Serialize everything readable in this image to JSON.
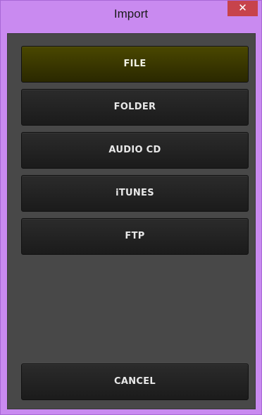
{
  "window": {
    "title": "Import",
    "close_glyph": "✕"
  },
  "buttons": [
    {
      "label": "FILE",
      "active": true
    },
    {
      "label": "FOLDER",
      "active": false
    },
    {
      "label": "AUDIO CD",
      "active": false
    },
    {
      "label": "iTUNES",
      "active": false
    },
    {
      "label": "FTP",
      "active": false
    }
  ],
  "cancel_label": "CANCEL",
  "colors": {
    "frame": "#c98af0",
    "close_button": "#c7434b",
    "panel": "#484848",
    "button": "#222222",
    "button_active": "#3a3800",
    "button_text": "#e8e8e8"
  }
}
